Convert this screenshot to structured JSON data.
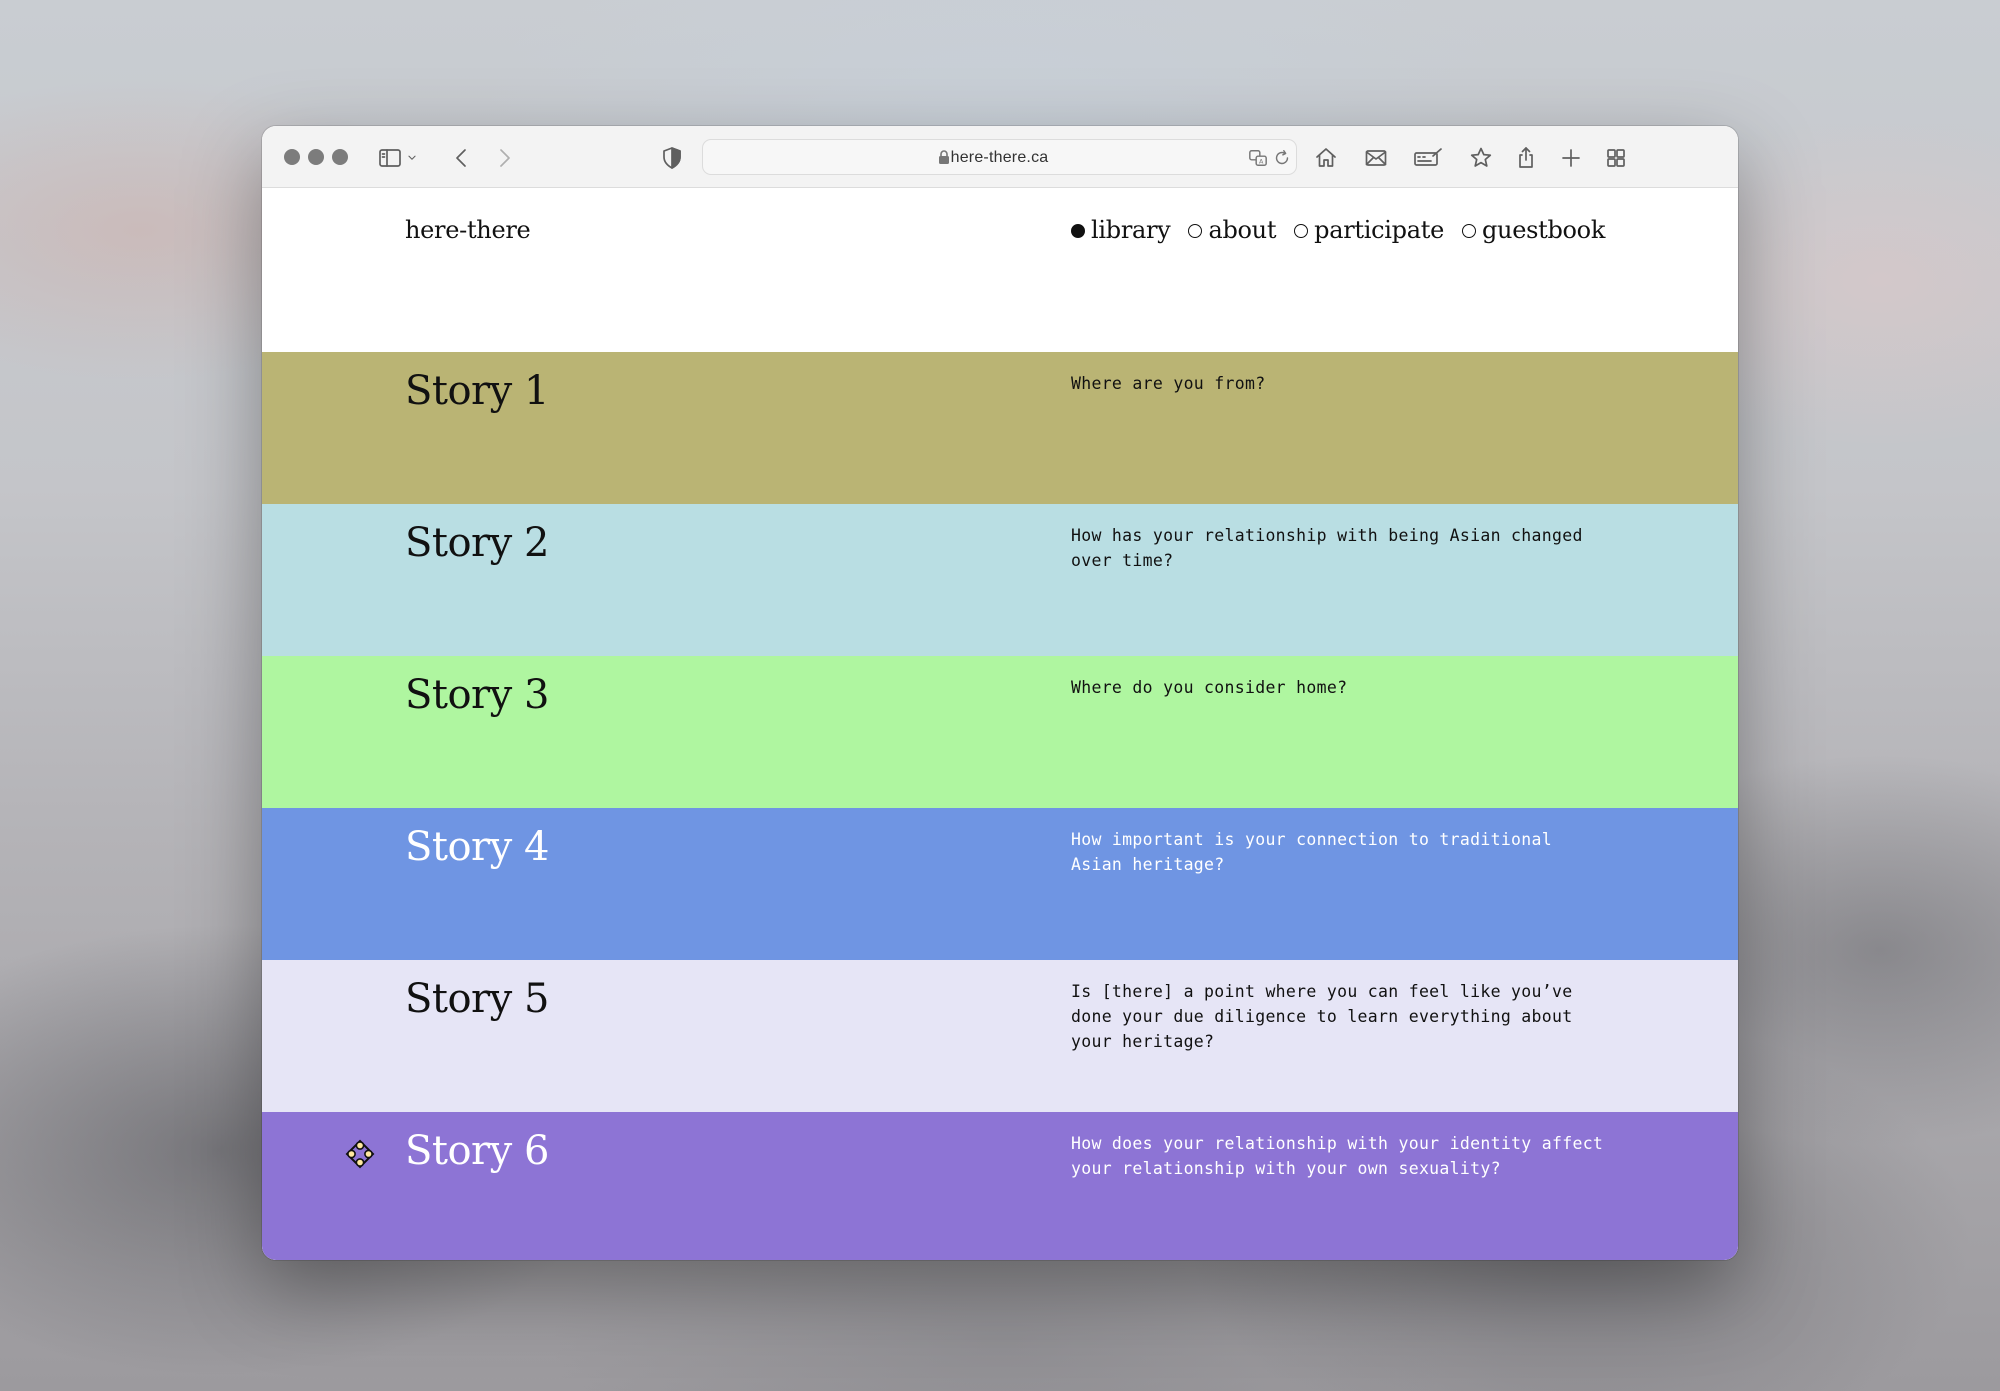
{
  "browser": {
    "url": "here-there.ca"
  },
  "site": {
    "logo": "here-there",
    "nav": [
      {
        "label": "library",
        "active": true
      },
      {
        "label": "about",
        "active": false
      },
      {
        "label": "participate",
        "active": false
      },
      {
        "label": "guestbook",
        "active": false
      }
    ]
  },
  "stories": [
    {
      "title": "Story 1",
      "question": "Where are you from?",
      "bg": "#bab474",
      "text": "#111111"
    },
    {
      "title": "Story 2",
      "question": "How has your relationship with being Asian changed over time?",
      "bg": "#b9dee3",
      "text": "#111111"
    },
    {
      "title": "Story 3",
      "question": "Where do you consider home?",
      "bg": "#aff6a0",
      "text": "#111111"
    },
    {
      "title": "Story 4",
      "question": "How important is your connection to traditional Asian heritage?",
      "bg": "#6f95e3",
      "text": "#ffffff"
    },
    {
      "title": "Story 5",
      "question": "Is [there] a point where you can feel like you’ve done your due diligence to learn everything about your heritage?",
      "bg": "#e6e5f6",
      "text": "#111111"
    },
    {
      "title": "Story 6",
      "question": "How does your relationship with your identity affect your relationship with your own sexuality?",
      "bg": "#8d74d5",
      "text": "#ffffff"
    }
  ]
}
